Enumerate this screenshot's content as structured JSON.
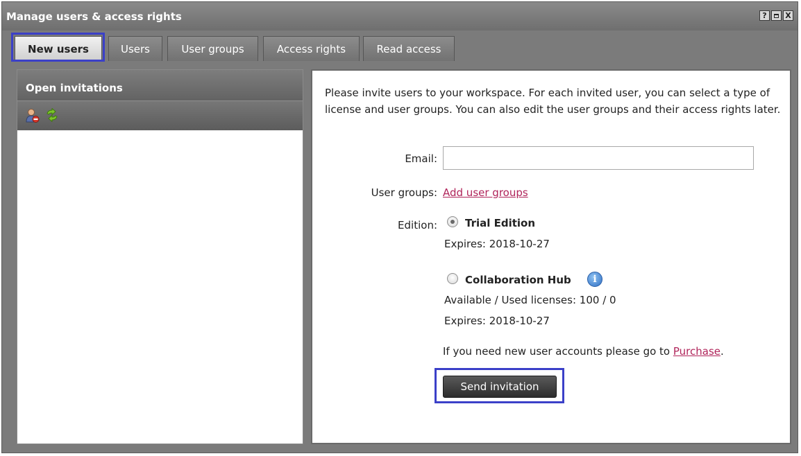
{
  "window": {
    "title": "Manage users & access rights",
    "help_label": "?",
    "close_label": "X"
  },
  "tabs": [
    {
      "label": "New users",
      "active": true
    },
    {
      "label": "Users",
      "active": false
    },
    {
      "label": "User groups",
      "active": false
    },
    {
      "label": "Access rights",
      "active": false
    },
    {
      "label": "Read access",
      "active": false
    }
  ],
  "left_panel": {
    "title": "Open invitations",
    "icons": [
      "remove-user-icon",
      "refresh-icon"
    ]
  },
  "form": {
    "intro": "Please invite users to your workspace. For each invited user, you can select a type of license and user groups. You can also edit the user groups and their access rights later.",
    "email_label": "Email:",
    "email_value": "",
    "user_groups_label": "User groups:",
    "add_user_groups_link": "Add user groups",
    "edition_label": "Edition:",
    "editions": [
      {
        "name": "Trial Edition",
        "selected": true,
        "expires": "Expires: 2018-10-27"
      },
      {
        "name": "Collaboration Hub",
        "selected": false,
        "licenses": "Available / Used licenses: 100 / 0",
        "expires": "Expires: 2018-10-27"
      }
    ],
    "purchase_text": "If you need new user accounts please go to ",
    "purchase_link": "Purchase",
    "purchase_suffix": ".",
    "send_button": "Send invitation"
  },
  "colors": {
    "highlight_outline": "#3b40c8",
    "link": "#b0245a"
  }
}
